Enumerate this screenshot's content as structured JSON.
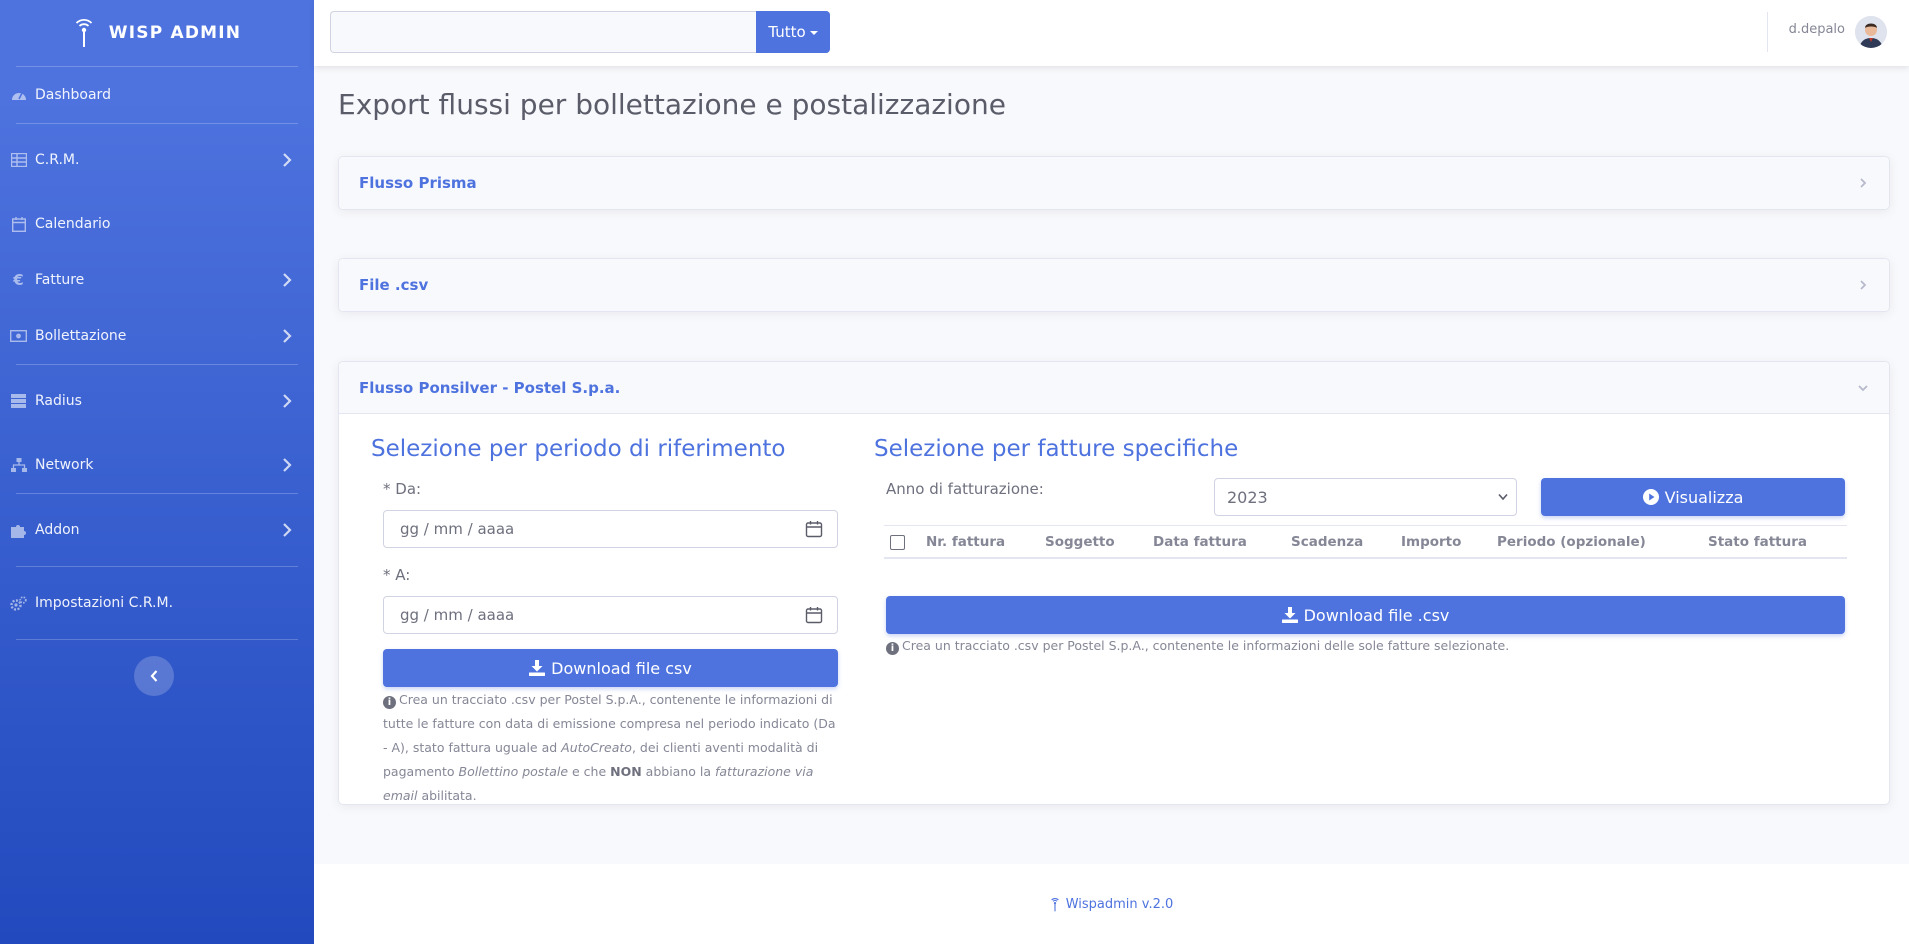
{
  "sidebar": {
    "brand": "WISP ADMIN",
    "items": [
      {
        "label": "Dashboard",
        "icon": "tachometer-icon",
        "has_submenu": false
      },
      {
        "label": "C.R.M.",
        "icon": "table-icon",
        "has_submenu": true
      },
      {
        "label": "Calendario",
        "icon": "calendar-icon",
        "has_submenu": false
      },
      {
        "label": "Fatture",
        "icon": "euro-icon",
        "has_submenu": true
      },
      {
        "label": "Bollettazione",
        "icon": "money-bill-icon",
        "has_submenu": true
      },
      {
        "label": "Radius",
        "icon": "server-icon",
        "has_submenu": true
      },
      {
        "label": "Network",
        "icon": "sitemap-icon",
        "has_submenu": true
      },
      {
        "label": "Addon",
        "icon": "puzzle-icon",
        "has_submenu": true
      },
      {
        "label": "Impostazioni C.R.M.",
        "icon": "cogs-icon",
        "has_submenu": false
      }
    ]
  },
  "topbar": {
    "search_value": "",
    "search_scope": "Tutto",
    "user_name": "d.depalo"
  },
  "page": {
    "title": "Export flussi per bollettazione e postalizzazione"
  },
  "cards": [
    {
      "title": "Flusso Prisma",
      "expanded": false
    },
    {
      "title": "File .csv",
      "expanded": false
    },
    {
      "title": "Flusso Ponsilver - Postel S.p.a.",
      "expanded": true
    }
  ],
  "period_section": {
    "title": "Selezione per periodo di riferimento",
    "from_label": "* Da:",
    "from_placeholder": "gg / mm / aaaa",
    "to_label": "* A:",
    "to_placeholder": "gg / mm / aaaa",
    "download_label": "Download file csv",
    "help": {
      "t1": "Crea un tracciato .csv per Postel S.p.A., contenente le informazioni di tutte le fatture con data di emissione compresa nel periodo indicato (Da - A), stato fattura uguale ad ",
      "t2": "AutoCreato",
      "t3": ", dei clienti aventi modalità di pagamento ",
      "t4": "Bollettino postale",
      "t5": " e che ",
      "t6": "NON",
      "t7": " abbiano la ",
      "t8": "fatturazione via email",
      "t9": " abilitata."
    }
  },
  "invoice_section": {
    "title": "Selezione per fatture specifiche",
    "year_label": "Anno di fatturazione:",
    "year_value": "2023",
    "view_label": "Visualizza",
    "columns": [
      "Nr. fattura",
      "Soggetto",
      "Data fattura",
      "Scadenza",
      "Importo",
      "Periodo (opzionale)",
      "Stato fattura"
    ],
    "download_label": "Download file .csv",
    "help": "Crea un tracciato .csv per Postel S.p.A., contenente le informazioni delle sole fatture selezionate."
  },
  "footer": {
    "version": "Wispadmin v.2.0"
  },
  "colors": {
    "primary": "#4e73df",
    "sidebar_gradient_end": "#224abe"
  }
}
